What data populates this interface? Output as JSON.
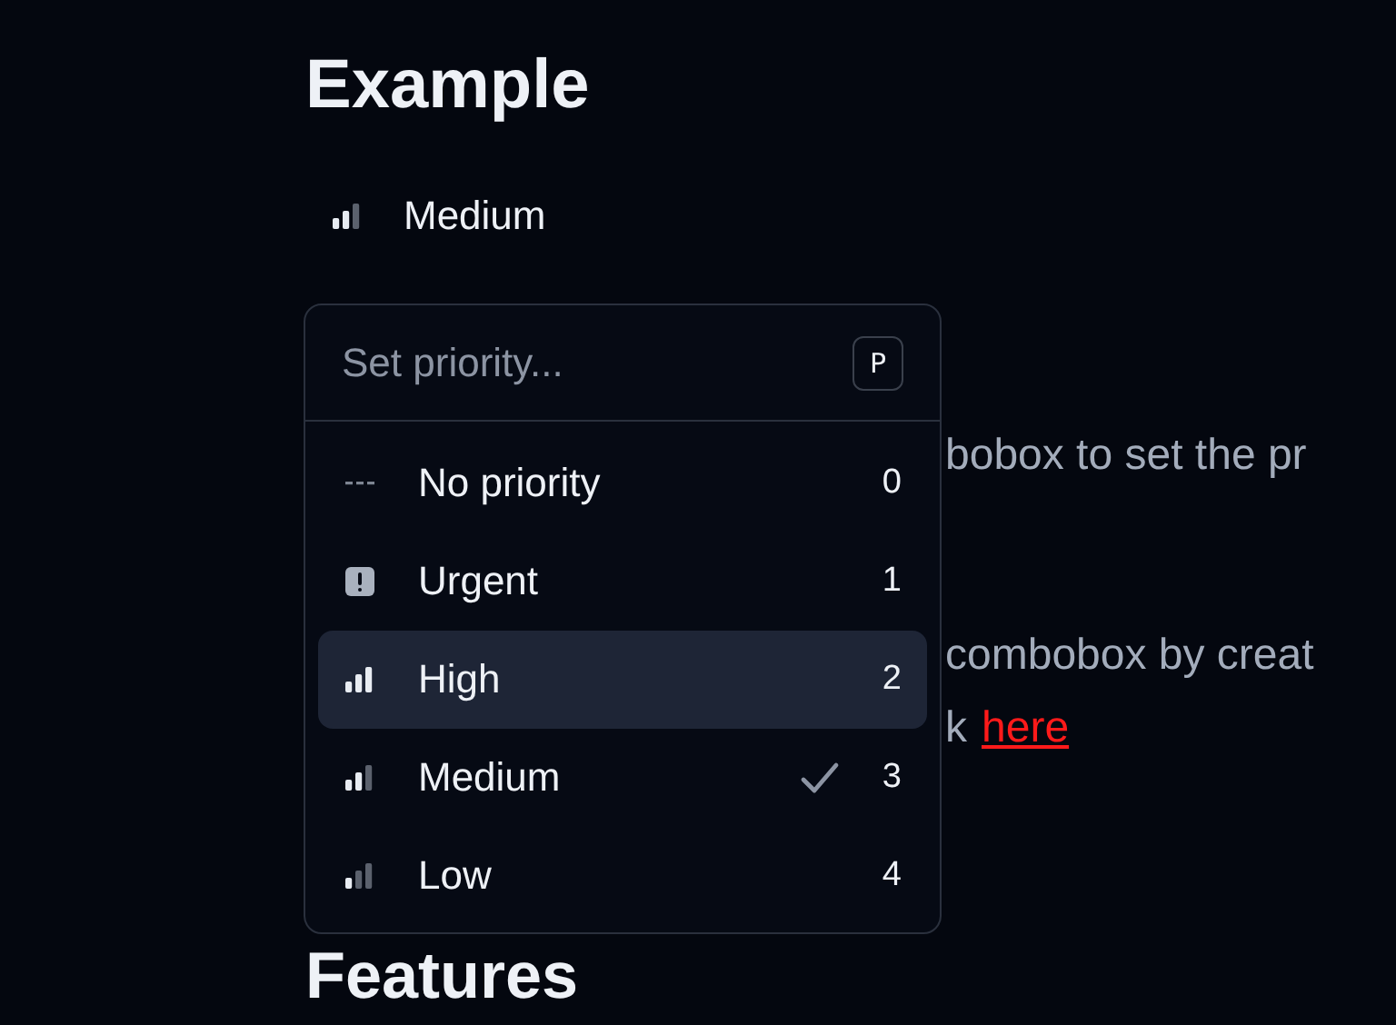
{
  "heading": "Example",
  "current": {
    "kind": "medium",
    "label": "Medium"
  },
  "paragraphs": [
    {
      "text": "bobox to set the pr"
    },
    {
      "text": "combobox by creat"
    },
    {
      "text": "k",
      "link": "here"
    }
  ],
  "heading_2": "Features",
  "popup": {
    "placeholder": "Set priority...",
    "shortcut": "P",
    "items": [
      {
        "kind": "no-priority",
        "label": "No priority",
        "key": "0",
        "selected": false,
        "checked": false
      },
      {
        "kind": "urgent",
        "label": "Urgent",
        "key": "1",
        "selected": false,
        "checked": false
      },
      {
        "kind": "high",
        "label": "High",
        "key": "2",
        "selected": true,
        "checked": false
      },
      {
        "kind": "medium",
        "label": "Medium",
        "key": "3",
        "selected": false,
        "checked": true
      },
      {
        "kind": "low",
        "label": "Low",
        "key": "4",
        "selected": false,
        "checked": false
      }
    ]
  }
}
